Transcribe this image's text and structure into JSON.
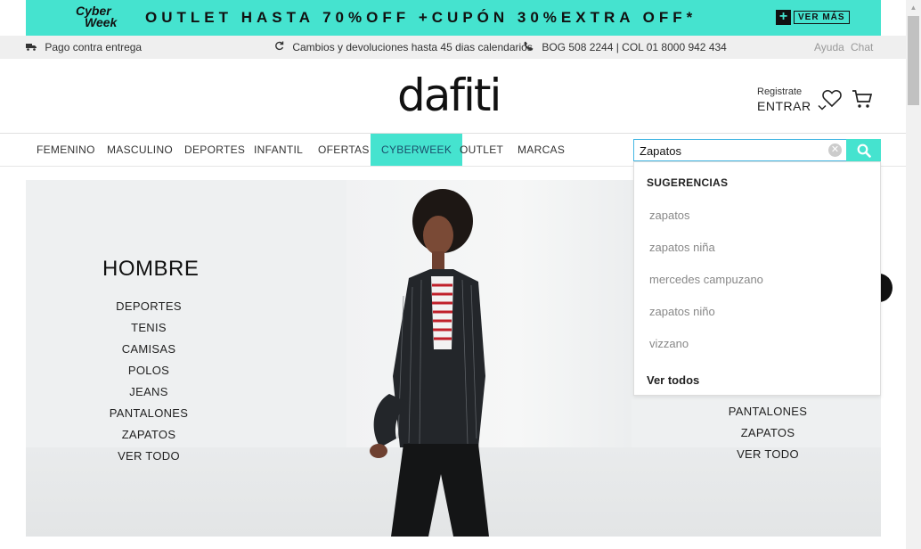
{
  "promo": {
    "logo_line1": "Cyber",
    "logo_line2": "Week",
    "text": "OUTLET HASTA 70%OFF +CUPÓN 30%EXTRA OFF*",
    "plus": "+",
    "button": "VER MÁS"
  },
  "infobar": {
    "delivery": "Pago contra entrega",
    "returns": "Cambios y devoluciones hasta 45 dias calendarios",
    "phone": "BOG 508 2244 | COL 01 8000 942 434",
    "help": "Ayuda",
    "chat": "Chat"
  },
  "header": {
    "logo": "dafiti",
    "register": "Registrate",
    "login": "ENTRAR"
  },
  "nav": {
    "items": [
      "FEMENINO",
      "MASCULINO",
      "DEPORTES",
      "INFANTIL",
      "OFERTAS",
      "CYBERWEEK",
      "OUTLET",
      "MARCAS"
    ],
    "active": "CYBERWEEK"
  },
  "search": {
    "value": "Zapatos",
    "dropdown_title": "SUGERENCIAS",
    "suggestions": [
      "zapatos",
      "zapatos niña",
      "mercedes campuzano",
      "zapatos niño",
      "vizzano"
    ],
    "see_all": "Ver todos"
  },
  "hero": {
    "left": {
      "title": "HOMBRE",
      "links": [
        "DEPORTES",
        "TENIS",
        "CAMISAS",
        "POLOS",
        "JEANS",
        "PANTALONES",
        "ZAPATOS",
        "VER TODO"
      ]
    },
    "right": {
      "links": [
        "PANTALONES",
        "ZAPATOS",
        "VER TODO"
      ]
    }
  },
  "colors": {
    "accent": "#45e3cf",
    "search_border": "#45b7e3",
    "info_bg": "#efefef"
  }
}
